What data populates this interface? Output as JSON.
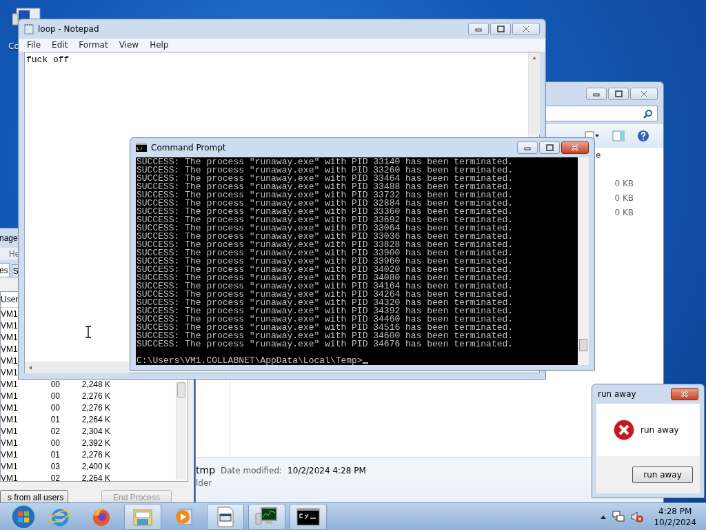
{
  "desktop": {
    "icons": [
      {
        "label": "Co"
      }
    ]
  },
  "explorer": {
    "size_column": "e",
    "sizes": [
      "0 KB",
      "0 KB",
      "0 KB"
    ],
    "details": {
      "name": "tmp",
      "date_label": "Date modified:",
      "date_value": "10/2/2024 4:28 PM",
      "type": "lder"
    }
  },
  "task_manager": {
    "title": "nage",
    "menu": [
      "He"
    ],
    "tabs": [
      {
        "label": "es",
        "selected": true
      },
      {
        "label": "S",
        "selected": false
      }
    ],
    "columns": [
      "User"
    ],
    "rows": [
      {
        "cells": [
          "VM1"
        ]
      },
      {
        "cells": [
          "VM1"
        ]
      },
      {
        "cells": [
          "VM1"
        ]
      },
      {
        "cells": [
          "VM1"
        ]
      },
      {
        "cells": [
          "VM1"
        ]
      },
      {
        "cells": [
          "VM1"
        ]
      },
      {
        "cells": [
          "VM1",
          "00",
          "2,248 K"
        ]
      },
      {
        "cells": [
          "VM1",
          "00",
          "2,276 K"
        ]
      },
      {
        "cells": [
          "VM1",
          "00",
          "2,276 K"
        ]
      },
      {
        "cells": [
          "VM1",
          "01",
          "2,264 K"
        ]
      },
      {
        "cells": [
          "VM1",
          "02",
          "2,304 K"
        ]
      },
      {
        "cells": [
          "VM1",
          "00",
          "2,392 K"
        ]
      },
      {
        "cells": [
          "VM1",
          "01",
          "2,276 K"
        ]
      },
      {
        "cells": [
          "VM1",
          "03",
          "2,400 K"
        ]
      },
      {
        "cells": [
          "VM1",
          "02",
          "2,264 K"
        ]
      }
    ],
    "buttons": [
      {
        "label": "s from all users",
        "disabled": false
      },
      {
        "label": "End Process",
        "disabled": true
      }
    ]
  },
  "notepad": {
    "title": "loop - Notepad",
    "menu": [
      "File",
      "Edit",
      "Format",
      "View",
      "Help"
    ],
    "text": "fuck off"
  },
  "command_prompt": {
    "title": "Command Prompt",
    "lines": [
      "SUCCESS: The process \"runaway.exe\" with PID 33140 has been terminated.",
      "SUCCESS: The process \"runaway.exe\" with PID 33260 has been terminated.",
      "SUCCESS: The process \"runaway.exe\" with PID 33464 has been terminated.",
      "SUCCESS: The process \"runaway.exe\" with PID 33488 has been terminated.",
      "SUCCESS: The process \"runaway.exe\" with PID 33732 has been terminated.",
      "SUCCESS: The process \"runaway.exe\" with PID 32884 has been terminated.",
      "SUCCESS: The process \"runaway.exe\" with PID 33360 has been terminated.",
      "SUCCESS: The process \"runaway.exe\" with PID 33692 has been terminated.",
      "SUCCESS: The process \"runaway.exe\" with PID 33064 has been terminated.",
      "SUCCESS: The process \"runaway.exe\" with PID 33036 has been terminated.",
      "SUCCESS: The process \"runaway.exe\" with PID 33828 has been terminated.",
      "SUCCESS: The process \"runaway.exe\" with PID 33900 has been terminated.",
      "SUCCESS: The process \"runaway.exe\" with PID 33960 has been terminated.",
      "SUCCESS: The process \"runaway.exe\" with PID 34020 has been terminated.",
      "SUCCESS: The process \"runaway.exe\" with PID 34080 has been terminated.",
      "SUCCESS: The process \"runaway.exe\" with PID 34164 has been terminated.",
      "SUCCESS: The process \"runaway.exe\" with PID 34264 has been terminated.",
      "SUCCESS: The process \"runaway.exe\" with PID 34320 has been terminated.",
      "SUCCESS: The process \"runaway.exe\" with PID 34392 has been terminated.",
      "SUCCESS: The process \"runaway.exe\" with PID 34460 has been terminated.",
      "SUCCESS: The process \"runaway.exe\" with PID 34516 has been terminated.",
      "SUCCESS: The process \"runaway.exe\" with PID 34600 has been terminated.",
      "SUCCESS: The process \"runaway.exe\" with PID 34676 has been terminated."
    ],
    "prompt": "C:\\Users\\VM1.COLLABNET\\AppData\\Local\\Temp>"
  },
  "dialog": {
    "title": "run away",
    "message": "run away",
    "button": "run away"
  },
  "taskbar": {
    "items": [
      {
        "kind": "ie",
        "running": false
      },
      {
        "kind": "firefox",
        "running": false
      },
      {
        "kind": "explorer",
        "running": true
      },
      {
        "kind": "media",
        "running": false
      },
      {
        "kind": "program",
        "running": true
      },
      {
        "kind": "monitor",
        "running": true
      },
      {
        "kind": "console",
        "running": true
      }
    ],
    "time": "4:28 PM",
    "date": "10/2/2024"
  }
}
